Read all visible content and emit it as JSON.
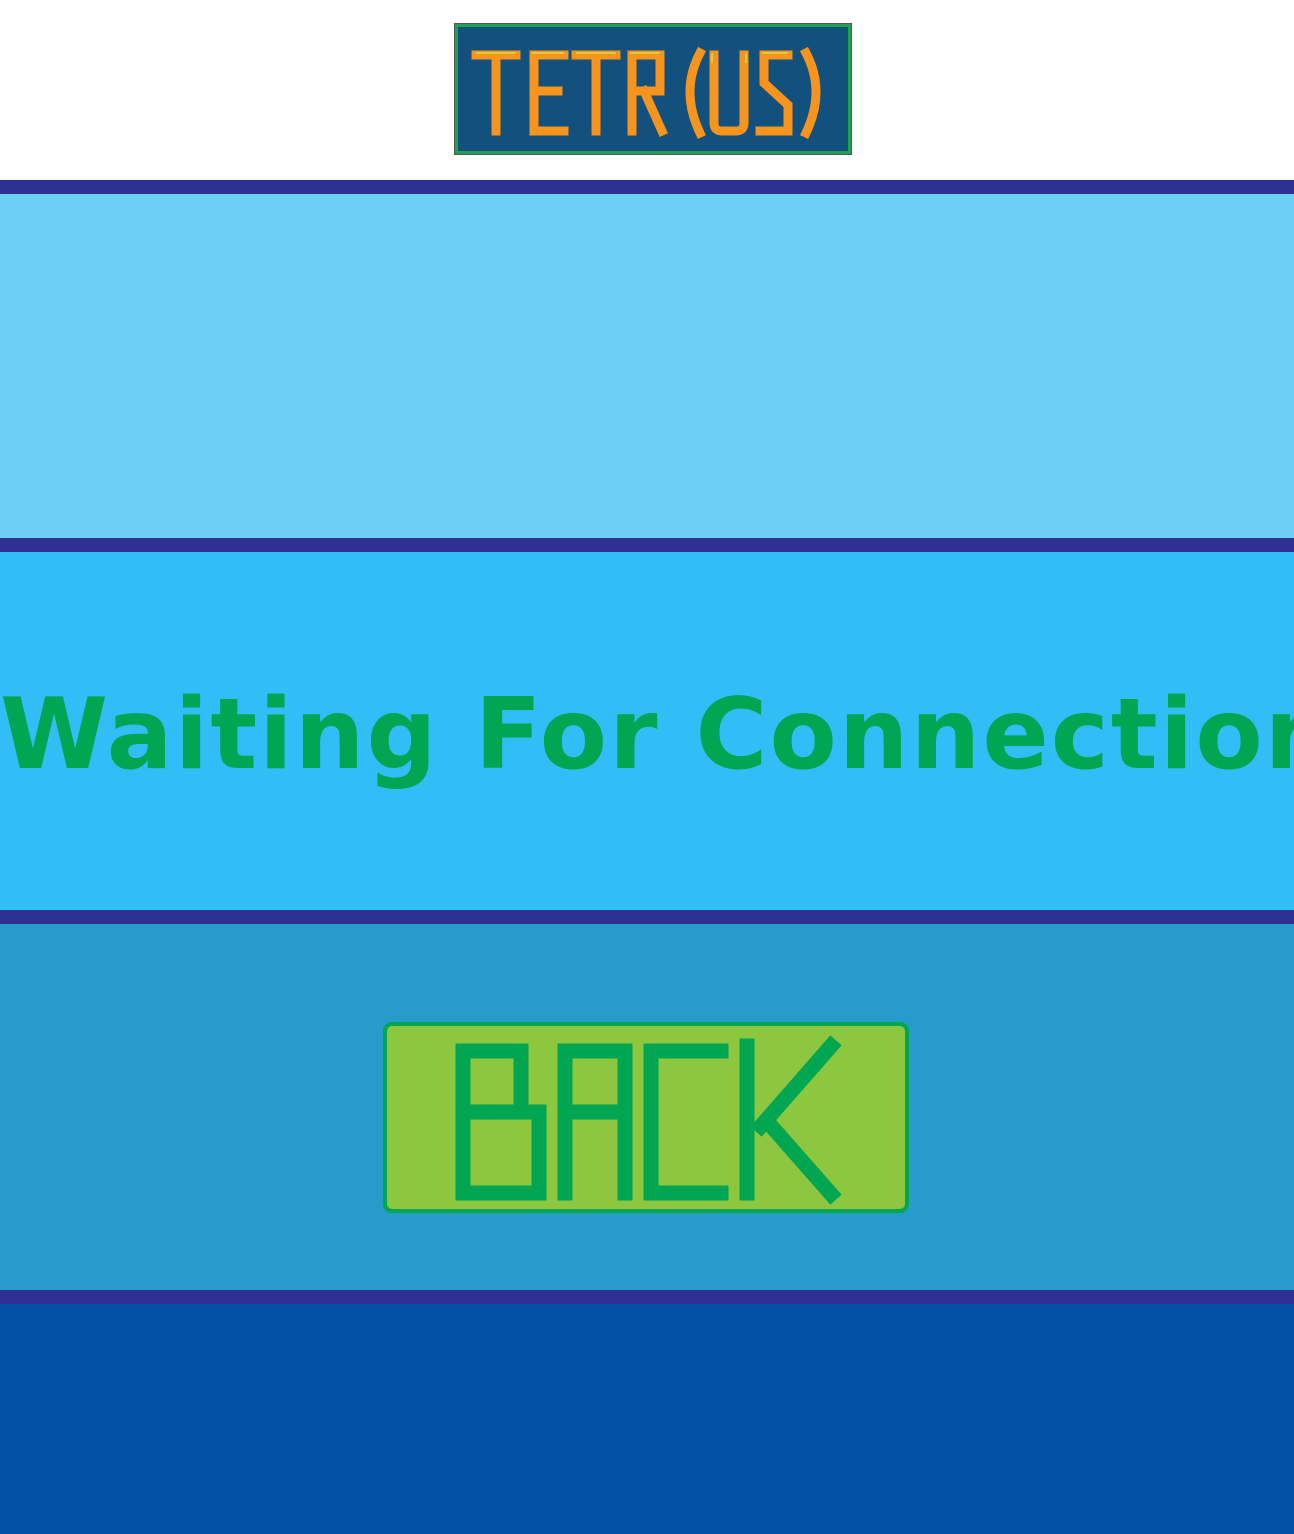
{
  "logo": {
    "text": "TETR(US)"
  },
  "status": {
    "text": "Waiting For Connection"
  },
  "back_button": {
    "label": "BACK"
  },
  "colors": {
    "divider": "#2e3192",
    "band_top": "#6ccff6",
    "band_middle": "#31bef7",
    "band_lower": "#279ccb",
    "band_bottom": "#0051a4",
    "text_green": "#00a651",
    "button_fill": "#8dc63f",
    "logo_bg": "#12507e",
    "logo_letters": "#f7941d"
  }
}
